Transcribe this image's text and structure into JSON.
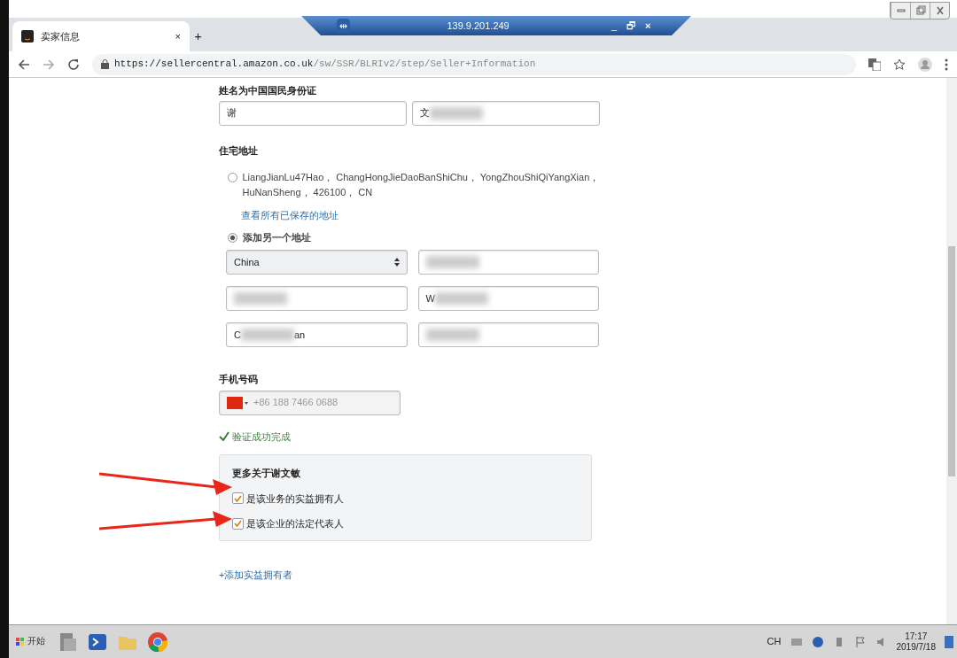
{
  "remote_bar": {
    "title": "139.9.201.249",
    "pin": "⇹",
    "minimize": "_",
    "restore": "🗗",
    "close": "×"
  },
  "browser": {
    "tab": {
      "title": "卖家信息",
      "close": "×",
      "selected": true
    },
    "new_tab": "+",
    "url_host": "https://sellercentral.amazon.co.uk",
    "url_path": "/sw/SSR/BLRIv2/step/Seller+Information"
  },
  "form": {
    "name_label": "姓名为中国国民身份证",
    "name_fields": [
      {
        "value": "谢",
        "redacted": false
      },
      {
        "value": "文",
        "redacted": true
      }
    ],
    "address_label": "住宅地址",
    "address_options": [
      {
        "kind": "saved",
        "text": "LiangJianLu47Hao， ChangHongJieDaoBanShiChu， YongZhouShiQiYangXian， HuNanSheng， 426100， CN",
        "selected": false
      },
      {
        "kind": "link",
        "text": "查看所有已保存的地址"
      },
      {
        "kind": "new",
        "text": "添加另一个地址",
        "selected": true
      }
    ],
    "address_fields": [
      {
        "kind": "select",
        "value": "China"
      },
      {
        "kind": "text",
        "redacted": true
      },
      {
        "kind": "text",
        "redacted": true
      },
      {
        "kind": "text",
        "value": "W",
        "redacted": true
      },
      {
        "kind": "text",
        "value": "C",
        "suffix": "an",
        "redacted": true
      },
      {
        "kind": "text",
        "redacted": true
      }
    ],
    "phone_label": "手机号码",
    "phone_value": "+86 188 7466 0688",
    "verified": "验证成功完成",
    "more": {
      "title": "更多关于谢文敏",
      "checks": [
        {
          "label": "是该业务的实益拥有人",
          "checked": true,
          "arrow": true
        },
        {
          "label": "是该企业的法定代表人",
          "checked": true,
          "arrow": true
        }
      ]
    },
    "add_link": "+添加实益拥有者"
  },
  "taskbar": {
    "start": "开始",
    "lang": "CH",
    "time": "17:17",
    "date": "2019/7/18"
  }
}
